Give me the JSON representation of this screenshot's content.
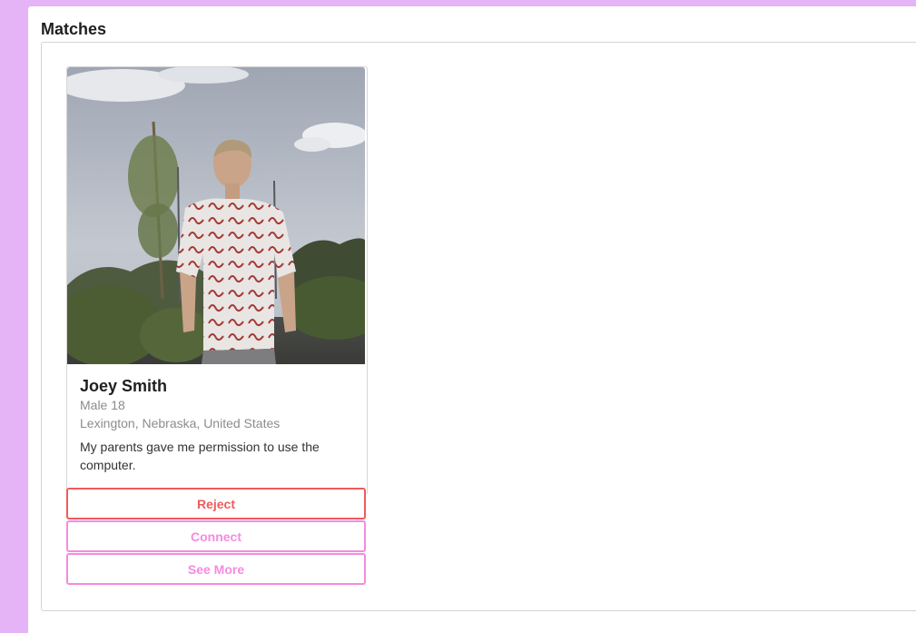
{
  "section": {
    "title": "Matches"
  },
  "profile": {
    "photo_alt": "Profile photo",
    "name": "Joey Smith",
    "gender_age": "Male 18",
    "location": "Lexington, Nebraska, United States",
    "bio": "My parents gave me permission to use the computer."
  },
  "actions": {
    "reject_label": "Reject",
    "connect_label": "Connect",
    "see_more_label": "See More"
  },
  "colors": {
    "background": "#e4b4f6",
    "reject": "#ef5b5b",
    "accent": "#f58be0"
  }
}
